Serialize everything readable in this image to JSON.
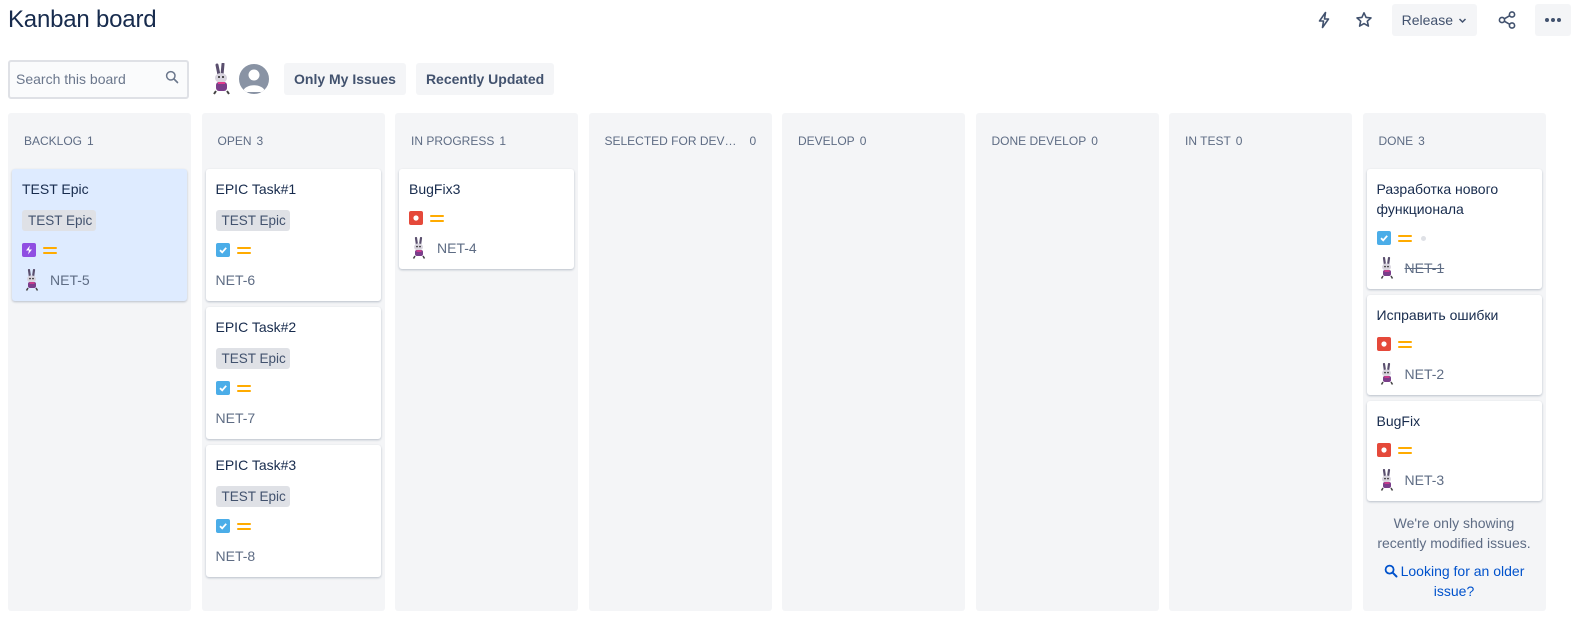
{
  "header": {
    "title": "Kanban board",
    "release_label": "Release",
    "icons": [
      "lightning-icon",
      "star-icon",
      "share-icon",
      "more-icon"
    ]
  },
  "toolbar": {
    "search_placeholder": "Search this board",
    "filters": [
      "Only My Issues",
      "Recently Updated"
    ]
  },
  "columns": [
    {
      "name": "BACKLOG",
      "count": "1"
    },
    {
      "name": "OPEN",
      "count": "3"
    },
    {
      "name": "IN PROGRESS",
      "count": "1"
    },
    {
      "name": "SELECTED FOR DEVELOP...",
      "count": "0"
    },
    {
      "name": "DEVELOP",
      "count": "0"
    },
    {
      "name": "DONE DEVELOP",
      "count": "0"
    },
    {
      "name": "IN TEST",
      "count": "0"
    },
    {
      "name": "DONE",
      "count": "3"
    }
  ],
  "cards": {
    "backlog": [
      {
        "title": "TEST Epic",
        "epic": "TEST Epic",
        "type": "epic",
        "key": "NET-5"
      }
    ],
    "open": [
      {
        "title": "EPIC Task#1",
        "epic": "TEST Epic",
        "type": "task",
        "key": "NET-6"
      },
      {
        "title": "EPIC Task#2",
        "epic": "TEST Epic",
        "type": "task",
        "key": "NET-7"
      },
      {
        "title": "EPIC Task#3",
        "epic": "TEST Epic",
        "type": "task",
        "key": "NET-8"
      }
    ],
    "in_progress": [
      {
        "title": "BugFix3",
        "type": "bug",
        "key": "NET-4"
      }
    ],
    "done": [
      {
        "title": "Разработка нового функционала",
        "type": "task",
        "key": "NET-1"
      },
      {
        "title": "Исправить ошибки",
        "type": "bug",
        "key": "NET-2"
      },
      {
        "title": "BugFix",
        "type": "bug",
        "key": "NET-3"
      }
    ]
  },
  "done_footer": {
    "note": "We're only showing recently modified issues.",
    "link": "Looking for an older issue?"
  },
  "colors": {
    "column_bg": "#f4f5f7",
    "task": "#4bade8",
    "bug": "#e5493a",
    "epic": "#904ee2",
    "priority_medium": "#ffab00",
    "link": "#0052cc",
    "selected_card": "#deebff"
  }
}
